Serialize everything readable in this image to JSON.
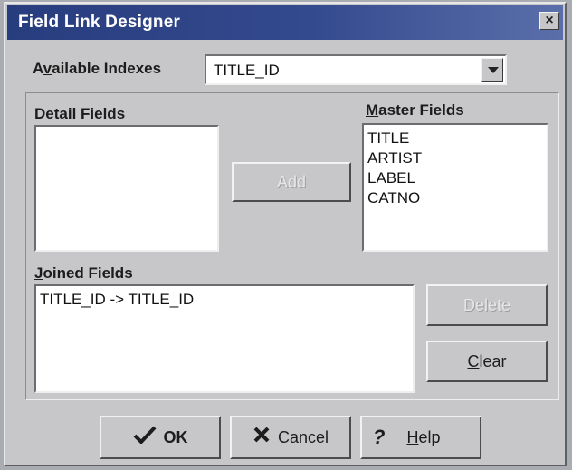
{
  "window": {
    "title": "Field Link Designer",
    "close_glyph": "×"
  },
  "available_indexes": {
    "label_prefix": "A",
    "label_mnemonic": "v",
    "label_suffix": "ailable Indexes",
    "value": "TITLE_ID"
  },
  "detail_fields": {
    "label_mnemonic": "D",
    "label_suffix": "etail Fields",
    "items": []
  },
  "master_fields": {
    "label_mnemonic": "M",
    "label_suffix": "aster Fields",
    "items": [
      "TITLE",
      "ARTIST",
      "LABEL",
      "CATNO"
    ]
  },
  "add_button": {
    "label": "Add",
    "enabled": false
  },
  "joined_fields": {
    "label_mnemonic": "J",
    "label_suffix": "oined Fields",
    "items": [
      "TITLE_ID -> TITLE_ID"
    ]
  },
  "delete_button": {
    "label": "Delete",
    "enabled": false
  },
  "clear_button": {
    "label_mnemonic": "C",
    "label_suffix": "lear"
  },
  "footer": {
    "ok": {
      "icon": "check-icon",
      "label": "OK"
    },
    "cancel": {
      "icon": "x-icon",
      "label": "Cancel"
    },
    "help": {
      "icon": "question-icon",
      "label_mnemonic": "H",
      "label_suffix": "elp"
    }
  }
}
